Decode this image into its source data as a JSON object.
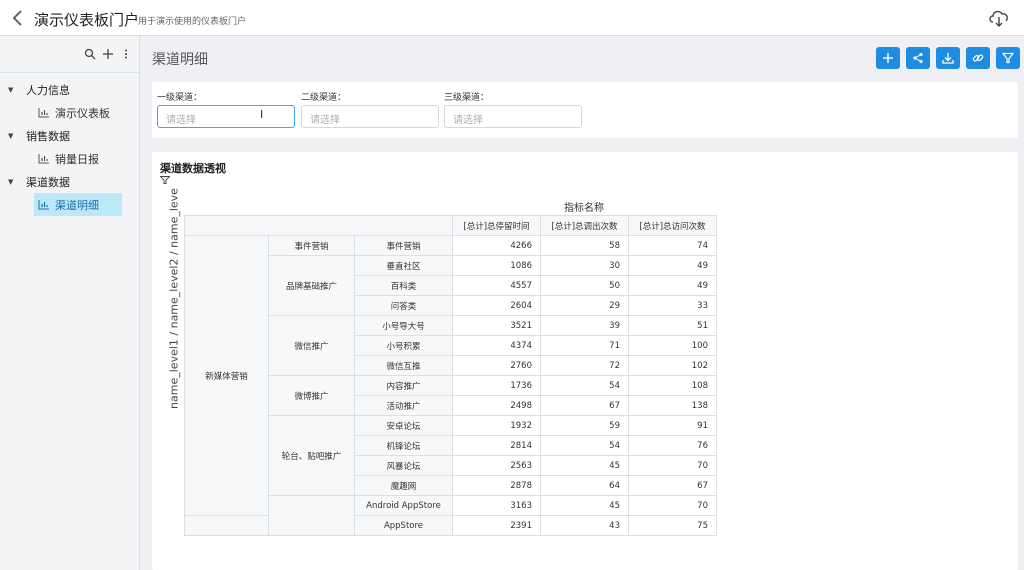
{
  "header": {
    "title": "演示仪表板门户",
    "subtitle": "用于演示使用的仪表板门户"
  },
  "sidebar": {
    "groups": [
      {
        "label": "人力信息",
        "items": [
          {
            "label": "演示仪表板",
            "active": false
          }
        ]
      },
      {
        "label": "销售数据",
        "items": [
          {
            "label": "销量日报",
            "active": false
          }
        ]
      },
      {
        "label": "渠道数据",
        "items": [
          {
            "label": "渠道明细",
            "active": true
          }
        ]
      }
    ]
  },
  "page": {
    "title": "渠道明细",
    "actions": [
      "add-icon",
      "share-icon",
      "download-icon",
      "link-icon",
      "filter-icon"
    ]
  },
  "filters": [
    {
      "label": "一级渠道：",
      "placeholder": "请选择"
    },
    {
      "label": "二级渠道：",
      "placeholder": "请选择"
    },
    {
      "label": "三级渠道：",
      "placeholder": "请选择"
    }
  ],
  "pivot": {
    "title": "渠道数据透视",
    "column_header": "指标名称",
    "row_axis_label": "name_level1 / name_level2 / name_leve",
    "columns": [
      "[总计]总停留时间",
      "[总计]总调出次数",
      "[总计]总访问次数"
    ],
    "level1": [
      {
        "label": "新媒体营销",
        "span": 14
      },
      {
        "label": "",
        "span": 2
      }
    ],
    "level2": [
      {
        "label": "事件营销",
        "span": 1
      },
      {
        "label": "品牌基础推广",
        "span": 3
      },
      {
        "label": "微信推广",
        "span": 3
      },
      {
        "label": "微博推广",
        "span": 2
      },
      {
        "label": "轮台、贴吧推广",
        "span": 4
      },
      {
        "label": "",
        "span": 2
      }
    ],
    "rows": [
      {
        "level3": "事件营销",
        "values": [
          "4266",
          "58",
          "74"
        ]
      },
      {
        "level3": "垂直社区",
        "values": [
          "1086",
          "30",
          "49"
        ]
      },
      {
        "level3": "百科类",
        "values": [
          "4557",
          "50",
          "49"
        ]
      },
      {
        "level3": "问答类",
        "values": [
          "2604",
          "29",
          "33"
        ]
      },
      {
        "level3": "小号导大号",
        "values": [
          "3521",
          "39",
          "51"
        ]
      },
      {
        "level3": "小号积累",
        "values": [
          "4374",
          "71",
          "100"
        ]
      },
      {
        "level3": "微信互推",
        "values": [
          "2760",
          "72",
          "102"
        ]
      },
      {
        "level3": "内容推广",
        "values": [
          "1736",
          "54",
          "108"
        ]
      },
      {
        "level3": "活动推广",
        "values": [
          "2498",
          "67",
          "138"
        ]
      },
      {
        "level3": "安卓论坛",
        "values": [
          "1932",
          "59",
          "91"
        ]
      },
      {
        "level3": "机锋论坛",
        "values": [
          "2814",
          "54",
          "76"
        ]
      },
      {
        "level3": "风暴论坛",
        "values": [
          "2563",
          "45",
          "70"
        ]
      },
      {
        "level3": "魔趣网",
        "values": [
          "2878",
          "64",
          "67"
        ]
      },
      {
        "level3": "Android AppStore",
        "values": [
          "3163",
          "45",
          "70"
        ]
      },
      {
        "level3": "AppStore",
        "values": [
          "2391",
          "43",
          "75"
        ]
      }
    ]
  }
}
